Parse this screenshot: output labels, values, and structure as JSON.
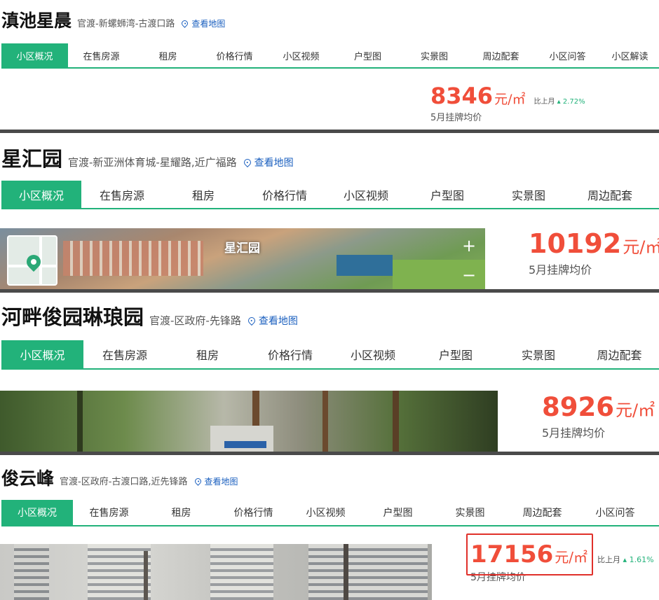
{
  "panels": [
    {
      "name": "滇池星晨",
      "address": "官渡-新螺蛳湾-古渡口路",
      "map_link": "查看地图",
      "tabs": [
        "小区概况",
        "在售房源",
        "租房",
        "价格行情",
        "小区视频",
        "户型图",
        "实景图",
        "周边配套",
        "小区问答",
        "小区解读"
      ],
      "active_tab": 0,
      "price": "8346",
      "unit": "元/㎡",
      "price_label": "5月挂牌均价",
      "compare_label": "比上月",
      "compare_value": "2.72%"
    },
    {
      "name": "星汇园",
      "address": "官渡-新亚洲体育城-星耀路,近广福路",
      "map_link": "查看地图",
      "tabs": [
        "小区概况",
        "在售房源",
        "租房",
        "价格行情",
        "小区视频",
        "户型图",
        "实景图",
        "周边配套"
      ],
      "active_tab": 0,
      "price": "10192",
      "unit": "元/㎡",
      "price_label": "5月挂牌均价",
      "photo_label": "星汇园",
      "zoom_in": "+",
      "zoom_out": "−"
    },
    {
      "name": "河畔俊园琳琅园",
      "address": "官渡-区政府-先锋路",
      "map_link": "查看地图",
      "tabs": [
        "小区概况",
        "在售房源",
        "租房",
        "价格行情",
        "小区视频",
        "户型图",
        "实景图",
        "周边配套"
      ],
      "active_tab": 0,
      "price": "8926",
      "unit": "元/㎡",
      "price_label": "5月挂牌均价"
    },
    {
      "name": "俊云峰",
      "address": "官渡-区政府-古渡口路,近先锋路",
      "map_link": "查看地图",
      "tabs": [
        "小区概况",
        "在售房源",
        "租房",
        "价格行情",
        "小区视频",
        "户型图",
        "实景图",
        "周边配套",
        "小区问答"
      ],
      "active_tab": 0,
      "price": "17156",
      "unit": "元/㎡",
      "price_label": "5月挂牌均价",
      "compare_label": "比上月",
      "compare_value": "1.61%"
    }
  ],
  "colors": {
    "accent_green": "#22b27a",
    "price_red": "#f04e3a",
    "link_blue": "#1a5fbf",
    "highlight_box": "#e0302a"
  },
  "icons": [
    "location-pin-icon",
    "trend-up-icon",
    "zoom-in-icon",
    "zoom-out-icon"
  ]
}
